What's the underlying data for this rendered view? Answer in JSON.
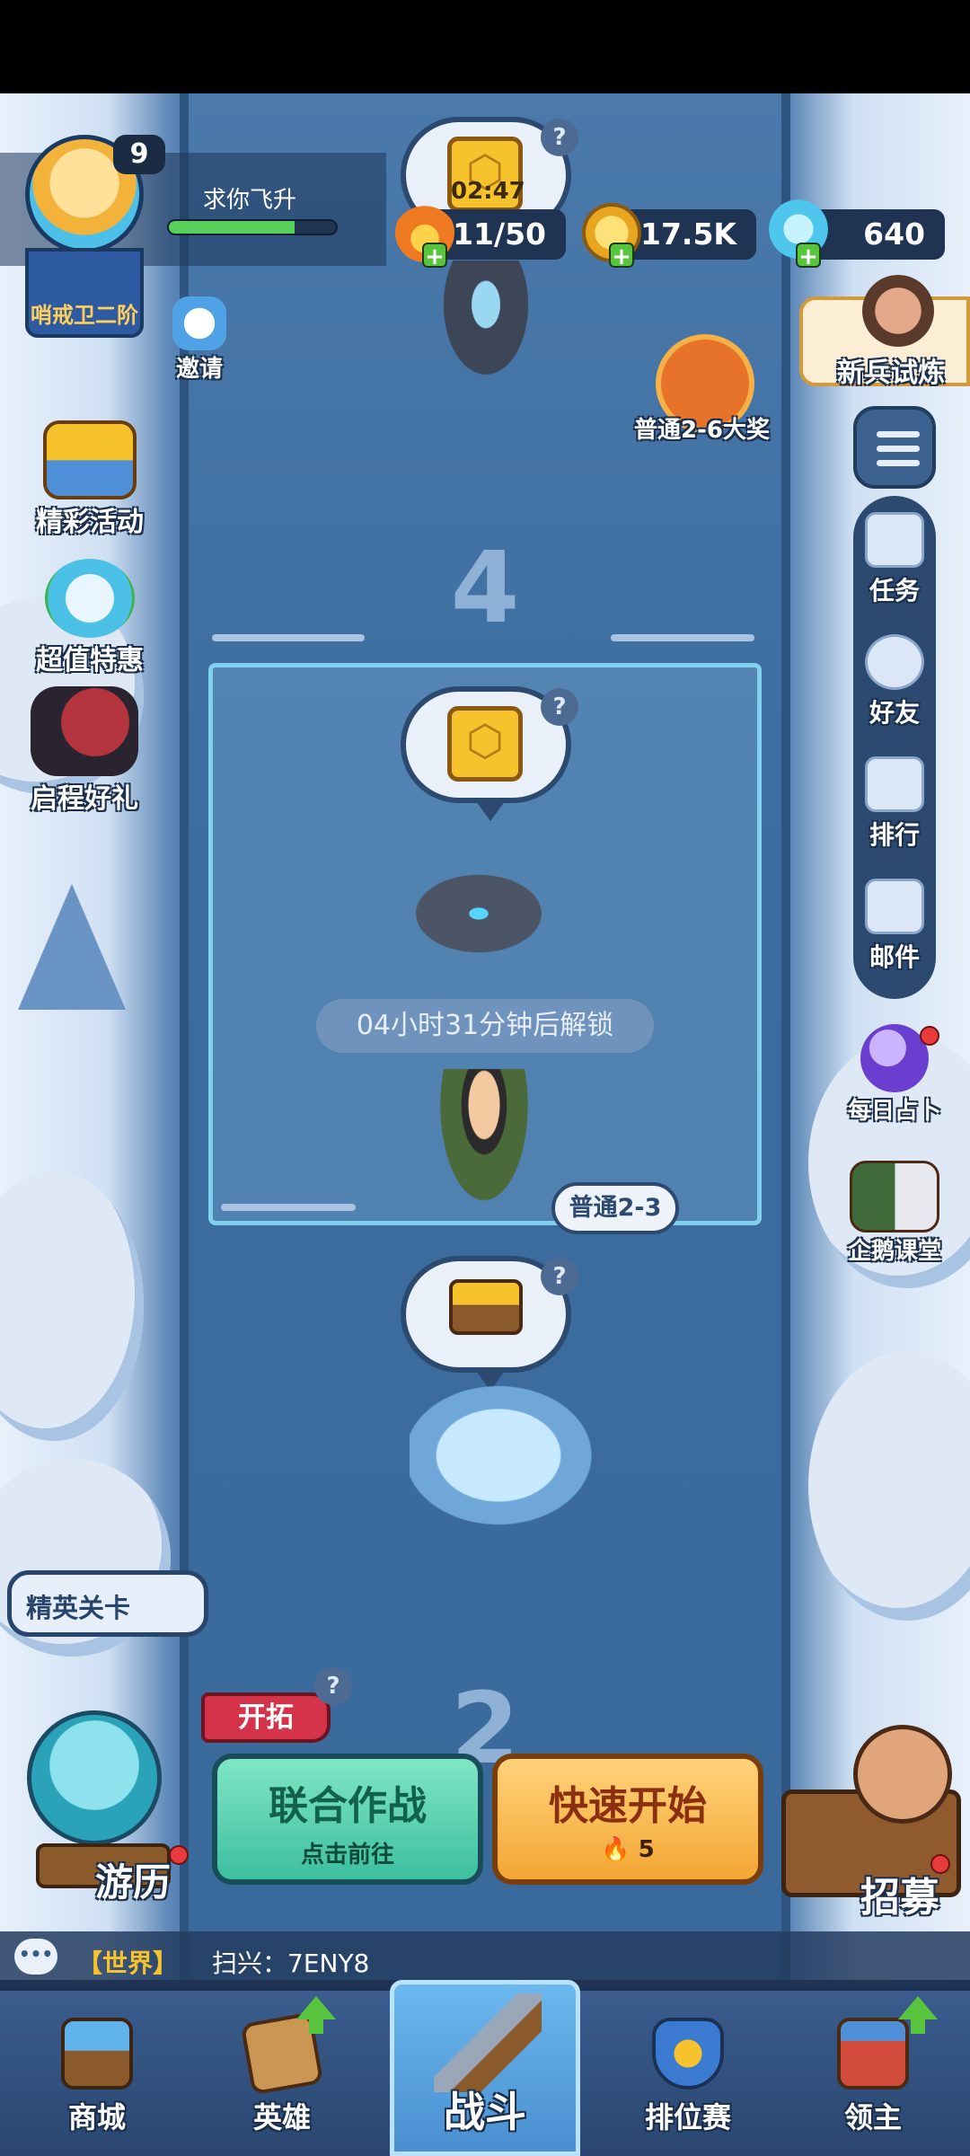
{
  "player": {
    "level": "9",
    "name": "求你飞升",
    "rank": "哨戒卫二阶",
    "xp_fraction": 0.75
  },
  "resources": {
    "energy": "11/50",
    "gold": "17.5K",
    "gems": "640"
  },
  "top_chest_timer": "02:47",
  "left_menu": {
    "invite": "邀请",
    "events": "精彩活动",
    "deals": "超值特惠",
    "start_gift": "启程好礼"
  },
  "right_menu": {
    "trial": "新兵试炼",
    "reward": "普通2-6大奖",
    "tasks": "任务",
    "friends": "好友",
    "ranking": "排行",
    "mail": "邮件",
    "divination": "每日占卜",
    "classroom": "企鹅课堂"
  },
  "stages": {
    "stage4_number": "4",
    "stage2_number": "2",
    "unlock_text": "04小时31分钟后解锁",
    "current_stage_tag": "普通2-3",
    "question_mark": "?"
  },
  "elite_levels": "精英关卡",
  "explore_tag": "开拓",
  "buttons": {
    "coop_title": "联合作战",
    "coop_sub": "点击前往",
    "quick_title": "快速开始",
    "quick_cost": "5"
  },
  "bottom_extras": {
    "travel": "游历",
    "recruit": "招募"
  },
  "chat": {
    "channel": "【世界】",
    "message": "扫兴：7ENY8"
  },
  "nav": {
    "shop": "商城",
    "heroes": "英雄",
    "battle": "战斗",
    "ranked": "排位赛",
    "lord": "领主"
  }
}
